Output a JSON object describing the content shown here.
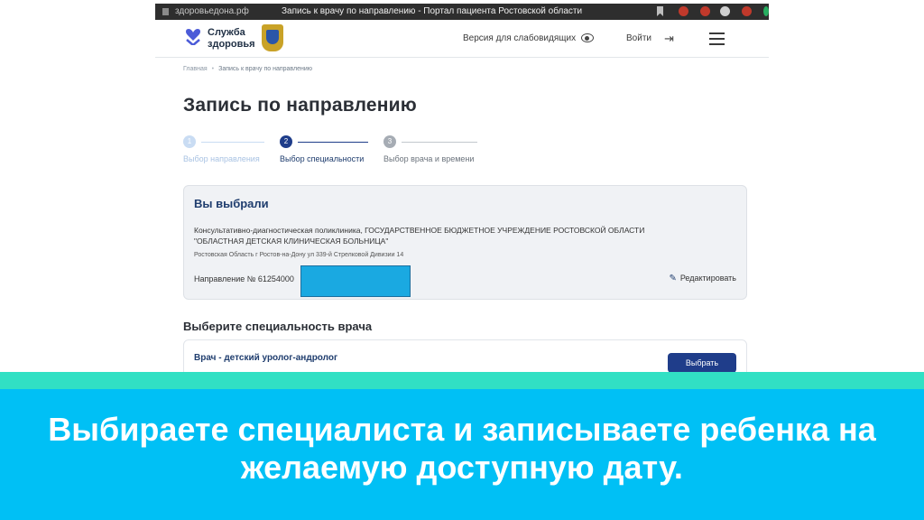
{
  "browser": {
    "url": "здоровьедона.рф",
    "title": "Запись к врачу по направлению - Портал пациента Ростовской области"
  },
  "header": {
    "logo_line1": "Служба",
    "logo_line2": "здоровья",
    "accessibility_label": "Версия для слабовидящих",
    "login_label": "Войти"
  },
  "breadcrumbs": {
    "home": "Главная",
    "current": "Запись к врачу по направлению"
  },
  "page_title": "Запись по направлению",
  "stepper": [
    {
      "number": "1",
      "label": "Выбор направления",
      "state": "done"
    },
    {
      "number": "2",
      "label": "Выбор специальности",
      "state": "active"
    },
    {
      "number": "3",
      "label": "Выбор врача и времени",
      "state": "pending"
    }
  ],
  "selection": {
    "title": "Вы выбрали",
    "clinic_line1": "Консультативно-диагностическая поликлиника, ГОСУДАРСТВЕННОЕ БЮДЖЕТНОЕ УЧРЕЖДЕНИЕ РОСТОВСКОЙ ОБЛАСТИ",
    "clinic_line2": "\"ОБЛАСТНАЯ ДЕТСКАЯ КЛИНИЧЕСКАЯ БОЛЬНИЦА\"",
    "address": "Ростовская Область г Ростов-на-Дону ул 339-й Стрелковой Дивизии 14",
    "referral": "Направление № 61254000",
    "edit_label": "Редактировать"
  },
  "specialty_section": {
    "title": "Выберите специальность врача",
    "items": [
      {
        "name": "Врач - детский уролог-андролог",
        "button": "Выбрать"
      }
    ]
  },
  "caption": {
    "line1": "Выбираете специалиста и записываете ребенка на",
    "line2": "желаемую доступную дату."
  },
  "colors": {
    "brand_blue": "#1f3d8a",
    "caption_banner": "#00c0f5",
    "caption_stripe": "#31e0c4",
    "redaction": "#1aa9e1"
  }
}
